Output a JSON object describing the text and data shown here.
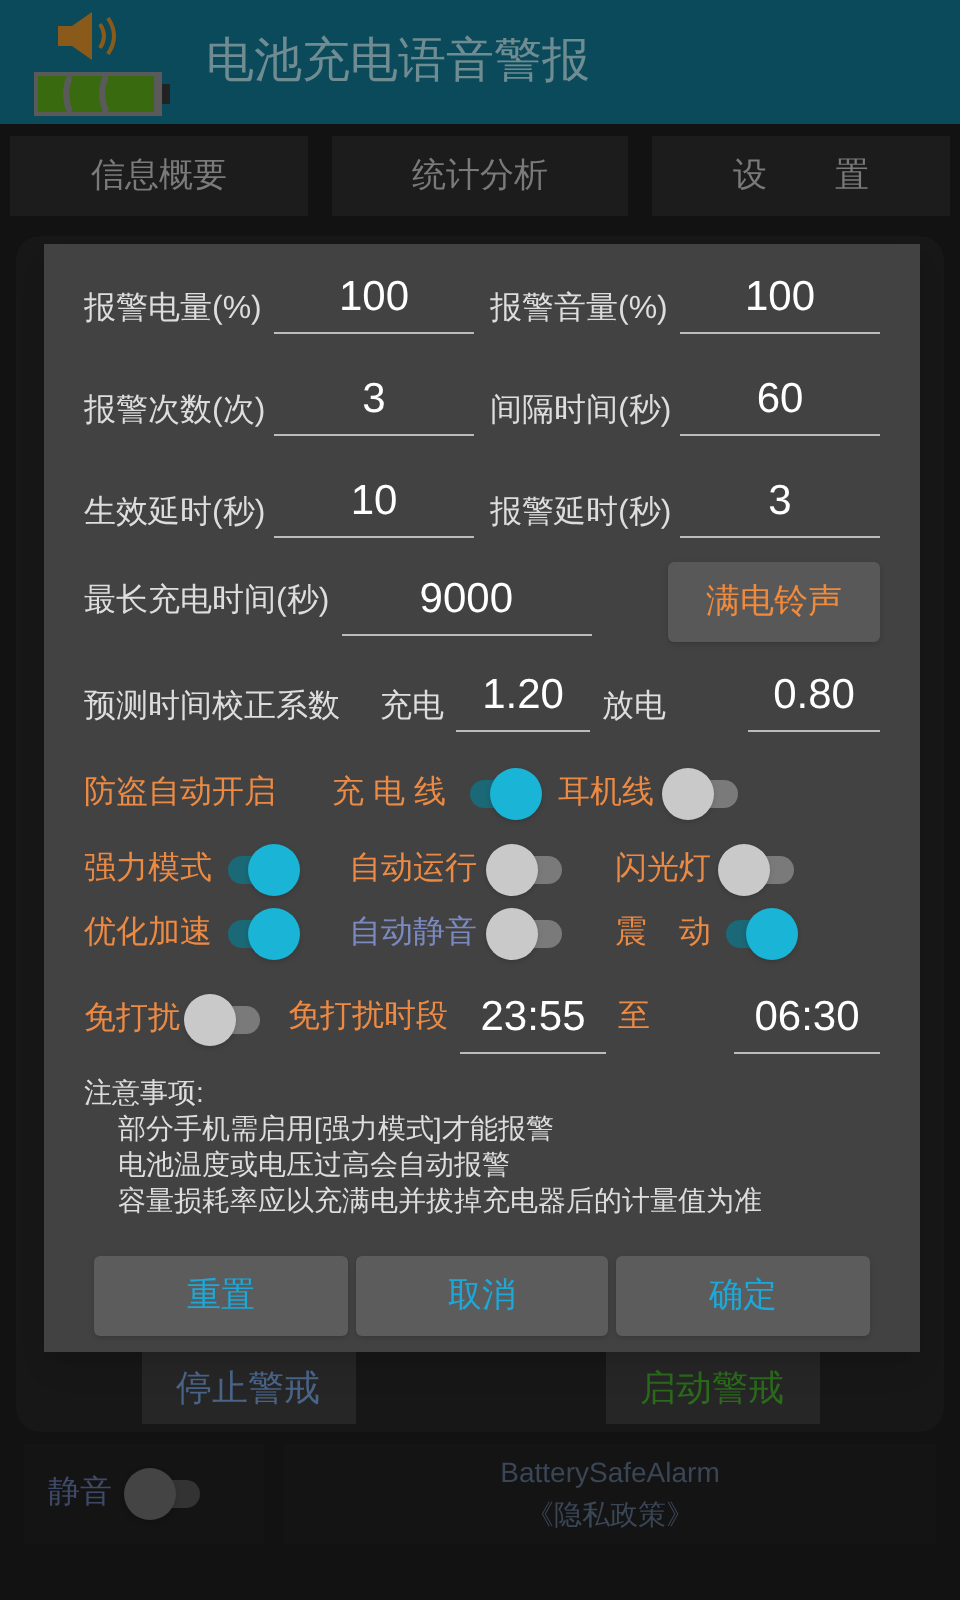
{
  "header": {
    "title": "电池充电语音警报"
  },
  "tabs": [
    {
      "label": "信息概要"
    },
    {
      "label": "统计分析"
    },
    {
      "label": "设　　置"
    }
  ],
  "background": {
    "buttons": [
      {
        "label": "停止警戒",
        "kind": "stop"
      },
      {
        "label": "启动警戒",
        "kind": "start"
      }
    ],
    "mute": {
      "label": "静音",
      "on": false
    },
    "footer": {
      "app": "BatterySafeAlarm",
      "privacy": "《隐私政策》"
    }
  },
  "dialog": {
    "fields": [
      {
        "label": "报警电量(%)",
        "value": "100"
      },
      {
        "label": "报警音量(%)",
        "value": "100"
      },
      {
        "label": "报警次数(次)",
        "value": "3"
      },
      {
        "label": "间隔时间(秒)",
        "value": "60"
      },
      {
        "label": "生效延时(秒)",
        "value": "10"
      },
      {
        "label": "报警延时(秒)",
        "value": "3"
      }
    ],
    "max_charge": {
      "label": "最长充电时间(秒)",
      "value": "9000"
    },
    "ringtone_button": "满电铃声",
    "calibration": {
      "label": "预测时间校正系数",
      "charge_label": "充电",
      "charge": "1.20",
      "discharge_label": "放电",
      "discharge": "0.80"
    },
    "anti_theft": {
      "label": "防盗自动开启",
      "switches": [
        {
          "label": "充 电 线",
          "on": true
        },
        {
          "label": "耳机线",
          "on": false
        }
      ]
    },
    "switches": [
      {
        "label": "强力模式",
        "on": true,
        "disabled": false
      },
      {
        "label": "自动运行",
        "on": false,
        "disabled": false
      },
      {
        "label": "闪光灯",
        "on": false,
        "disabled": false
      },
      {
        "label": "优化加速",
        "on": true,
        "disabled": false
      },
      {
        "label": "自动静音",
        "on": false,
        "disabled": true
      },
      {
        "label": "震　动",
        "on": true,
        "disabled": false
      }
    ],
    "dnd": {
      "label": "免打扰",
      "on": false,
      "period_label": "免打扰时段",
      "from": "23:55",
      "to_label": "至",
      "to": "06:30"
    },
    "notes": {
      "title": "注意事项:",
      "items": [
        "部分手机需启用[强力模式]才能报警",
        "电池温度或电压过高会自动报警",
        "容量损耗率应以充满电并拔掉充电器后的计量值为准"
      ]
    },
    "buttons": [
      "重置",
      "取消",
      "确定"
    ]
  }
}
